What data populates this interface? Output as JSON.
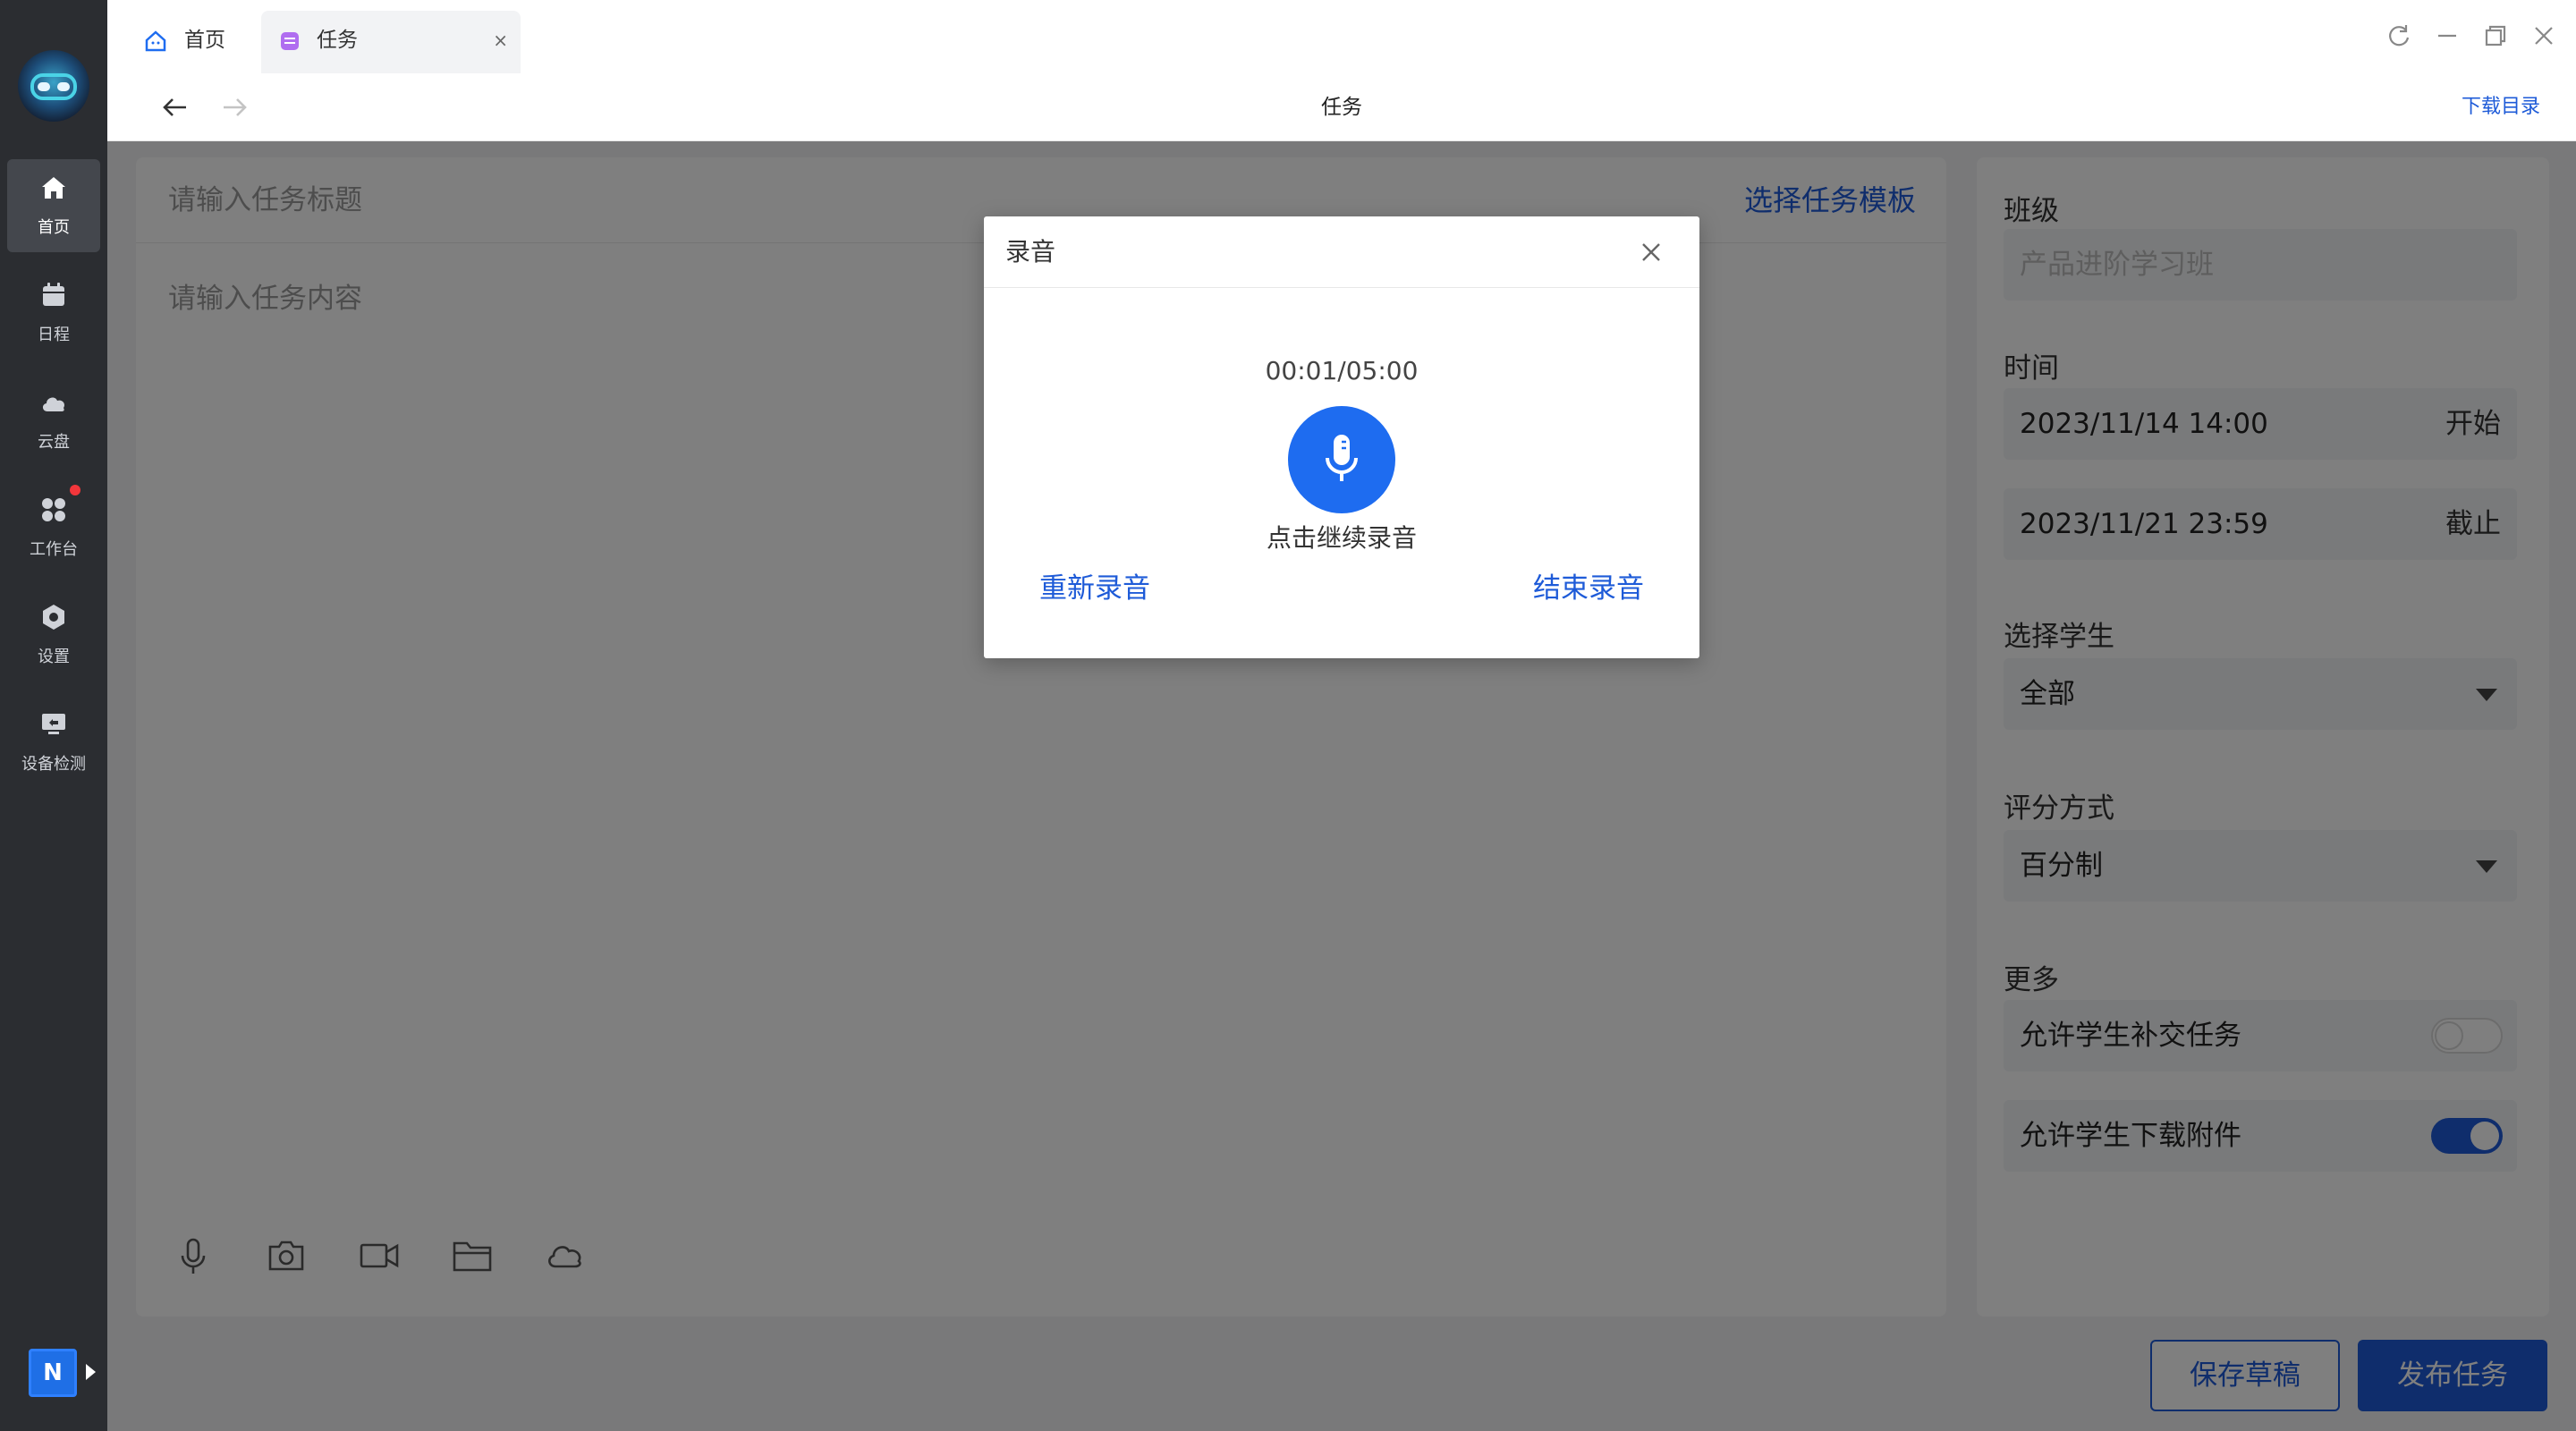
{
  "sidebar": {
    "items": [
      {
        "label": "首页",
        "icon": "home-icon",
        "active": true
      },
      {
        "label": "日程",
        "icon": "calendar-icon"
      },
      {
        "label": "云盘",
        "icon": "cloud-icon"
      },
      {
        "label": "工作台",
        "icon": "apps-icon"
      },
      {
        "label": "设置",
        "icon": "settings-icon"
      },
      {
        "label": "设备检测",
        "icon": "device-check-icon"
      }
    ],
    "badge": "N"
  },
  "tabs": [
    {
      "label": "首页",
      "icon": "home-tab-icon"
    },
    {
      "label": "任务",
      "icon": "task-tab-icon",
      "close": "×",
      "active": true
    }
  ],
  "navbar": {
    "title": "任务",
    "download_link": "下载目录"
  },
  "editor": {
    "title_placeholder": "请输入任务标题",
    "template_link": "选择任务模板",
    "content_placeholder": "请输入任务内容",
    "tools": [
      "mic-icon",
      "camera-icon",
      "video-icon",
      "folder-icon",
      "cloud-icon"
    ]
  },
  "side": {
    "class_label": "班级",
    "class_value": "产品进阶学习班",
    "time_label": "时间",
    "start_value": "2023/11/14 14:00",
    "start_suffix": "开始",
    "end_value": "2023/11/21 23:59",
    "end_suffix": "截止",
    "students_label": "选择学生",
    "students_value": "全部",
    "grading_label": "评分方式",
    "grading_value": "百分制",
    "more_label": "更多",
    "allow_late_label": "允许学生补交任务",
    "allow_late": false,
    "allow_download_label": "允许学生下载附件",
    "allow_download": true
  },
  "buttons": {
    "draft": "保存草稿",
    "publish": "发布任务"
  },
  "modal": {
    "title": "录音",
    "timer": "00:01/05:00",
    "hint": "点击继续录音",
    "rerecord": "重新录音",
    "finish": "结束录音"
  },
  "colors": {
    "accent": "#1e5bd8",
    "mic": "#1e6cf0",
    "sidebar": "#2b2d31",
    "dot": "#f2363b"
  }
}
